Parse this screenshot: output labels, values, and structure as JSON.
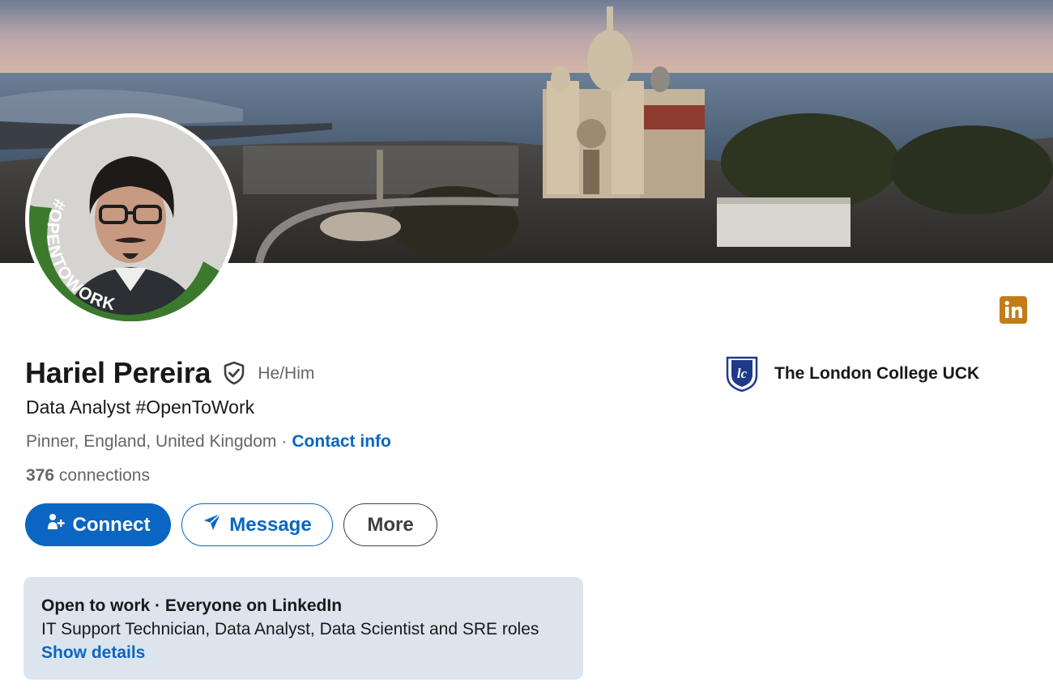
{
  "profile": {
    "name": "Hariel Pereira",
    "pronouns": "He/Him",
    "headline": "Data Analyst #OpenToWork",
    "location": "Pinner, England, United Kingdom",
    "separator": "·",
    "contact_info_label": "Contact info",
    "connections_count": "376",
    "connections_label": "connections",
    "avatar_frame_text": "#OPENTOWORK"
  },
  "actions": {
    "connect_label": "Connect",
    "message_label": "Message",
    "more_label": "More"
  },
  "open_to_work": {
    "title": "Open to work · Everyone on LinkedIn",
    "roles": "IT Support Technician, Data Analyst, Data Scientist and SRE roles",
    "show_details_label": "Show details"
  },
  "education": {
    "school_name": "The London College UCK"
  },
  "colors": {
    "primary_blue": "#0a66c2",
    "open_to_work_green": "#3b7a2c",
    "card_background": "#dce5ee",
    "linkedin_mark_gold": "#c37d16"
  },
  "icons": {
    "verified": "shield-check-icon",
    "connect": "person-add-icon",
    "message": "send-icon",
    "linkedin": "linkedin-icon",
    "school": "school-logo"
  }
}
